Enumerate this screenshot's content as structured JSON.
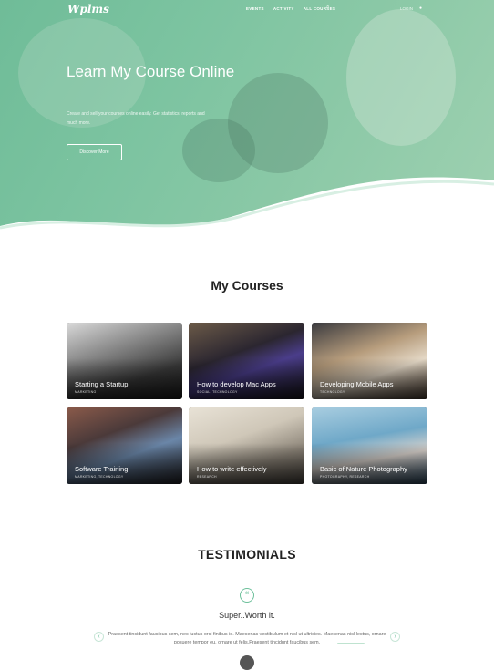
{
  "nav": {
    "logo": "Wplms",
    "links": [
      "EVENTS",
      "ACTIVITY",
      "ALL COURSES"
    ],
    "login": "LOGIN"
  },
  "hero": {
    "title": "Learn My Course Online",
    "subtitle": "Create and sell your courses online easily. Get statistics, reports and much more.",
    "button": "Discover More"
  },
  "courses": {
    "title": "My Courses",
    "items": [
      {
        "title": "Starting a Startup",
        "category": "MARKETING"
      },
      {
        "title": "How to develop Mac Apps",
        "category": "SOCIAL, TECHNOLOGY"
      },
      {
        "title": "Developing Mobile Apps",
        "category": "TECHNOLOGY"
      },
      {
        "title": "Software Training",
        "category": "MARKETING, TECHNOLOGY"
      },
      {
        "title": "How to write effectively",
        "category": "RESEARCH"
      },
      {
        "title": "Basic of Nature Photography",
        "category": "PHOTOGRAPHY, RESEARCH"
      }
    ]
  },
  "testimonials": {
    "title": "TESTIMONIALS",
    "headline": "Super..Worth it.",
    "text": "Praesent tincidunt faucibus sem, nec luctus orci finibus id. Maecenas vestibulum et nisl ut ultricies. Maecenas nisl lectus, ornare posuere tempor eu, ornare ut felis.Praesent tincidunt faucibus sem,"
  },
  "colors": {
    "accent": "#6dc09b",
    "hero_green": "#7dc4a1"
  }
}
